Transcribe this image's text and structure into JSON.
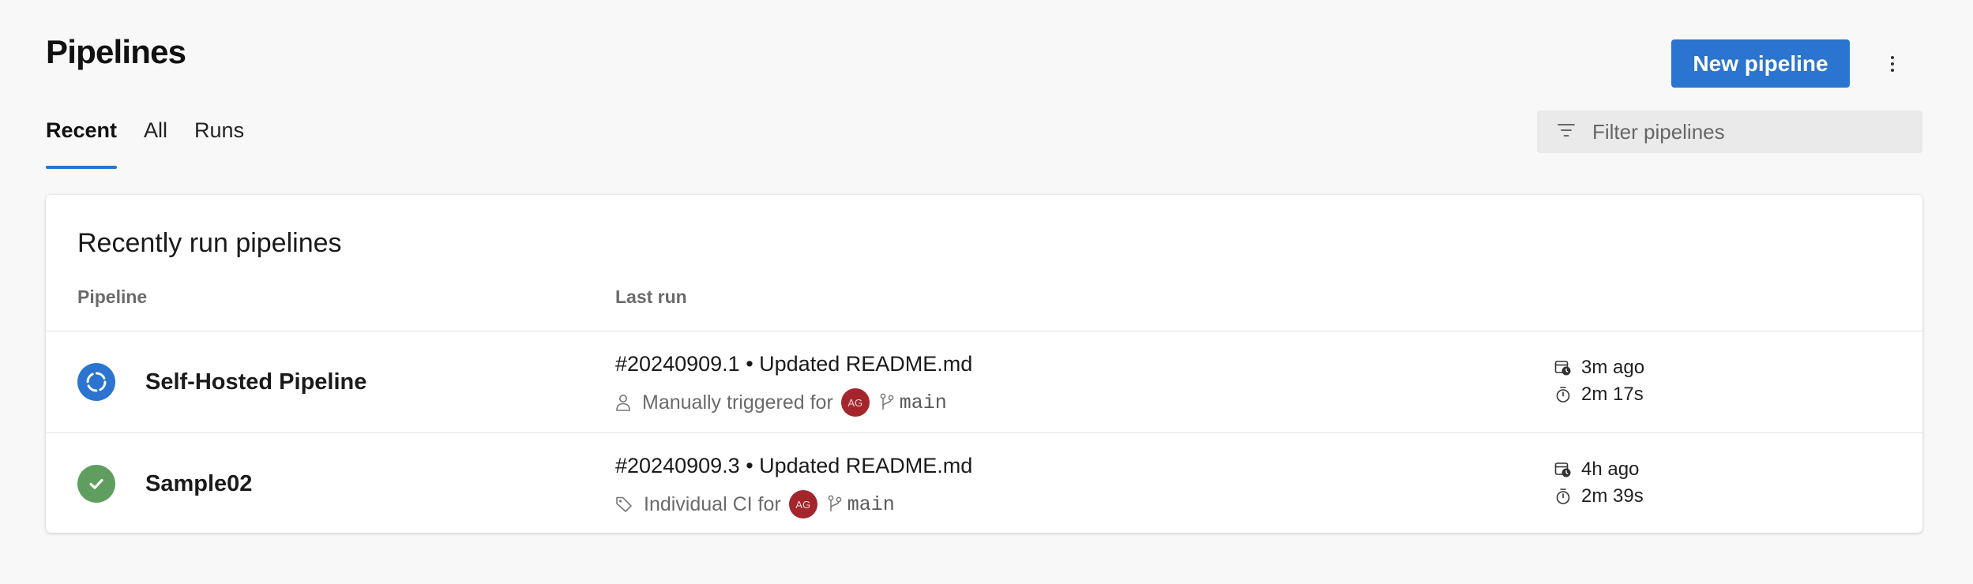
{
  "header": {
    "title": "Pipelines",
    "new_button_label": "New pipeline",
    "more_icon": "more-vertical-icon"
  },
  "tabs": [
    {
      "label": "Recent",
      "active": true
    },
    {
      "label": "All",
      "active": false
    },
    {
      "label": "Runs",
      "active": false
    }
  ],
  "filter": {
    "placeholder": "Filter pipelines",
    "value": "",
    "icon": "filter-icon"
  },
  "recent_card": {
    "title": "Recently run pipelines",
    "columns": {
      "pipeline": "Pipeline",
      "last_run": "Last run"
    },
    "rows": [
      {
        "status": "in-progress",
        "status_icon": "in-progress-icon",
        "status_color": "#2b74cf",
        "name": "Self-Hosted Pipeline",
        "run_id": "#20240909.1",
        "separator": "•",
        "commit_message": "Updated README.md",
        "trigger_icon": "person-icon",
        "trigger_text": "Manually triggered for",
        "avatar_initials": "AG",
        "branch_icon": "branch-icon",
        "branch": "main",
        "queued": "3m ago",
        "duration": "2m 17s"
      },
      {
        "status": "succeeded",
        "status_icon": "check-circle-icon",
        "status_color": "#5f9e5f",
        "name": "Sample02",
        "run_id": "#20240909.3",
        "separator": "•",
        "commit_message": "Updated README.md",
        "trigger_icon": "tag-icon",
        "trigger_text": "Individual CI for",
        "avatar_initials": "AG",
        "branch_icon": "branch-icon",
        "branch": "main",
        "queued": "4h ago",
        "duration": "2m 39s"
      }
    ]
  },
  "colors": {
    "accent": "#2b74cf",
    "avatar": "#a4262c",
    "success": "#5f9e5f",
    "background": "#f8f8f8"
  }
}
